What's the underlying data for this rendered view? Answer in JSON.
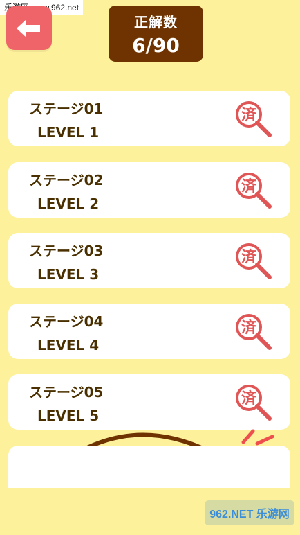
{
  "watermark": {
    "site": "乐游网 www.962.net",
    "logo_text": "962.NET 乐游网"
  },
  "header": {
    "back_icon": "arrow-left-icon",
    "score_label": "正解数",
    "score_value": "6/90"
  },
  "stages": [
    {
      "title": "ステージ01",
      "level": "LEVEL 1",
      "badge": "済"
    },
    {
      "title": "ステージ02",
      "level": "LEVEL 2",
      "badge": "済"
    },
    {
      "title": "ステージ03",
      "level": "LEVEL 3",
      "badge": "済"
    },
    {
      "title": "ステージ04",
      "level": "LEVEL 4",
      "badge": "済"
    },
    {
      "title": "ステージ05",
      "level": "LEVEL 5",
      "badge": "済"
    }
  ],
  "colors": {
    "background": "#fdf19b",
    "back_button": "#ef6468",
    "score_panel": "#6e3300",
    "card": "#ffffff",
    "text": "#4a3000",
    "badge": "#e05555"
  }
}
